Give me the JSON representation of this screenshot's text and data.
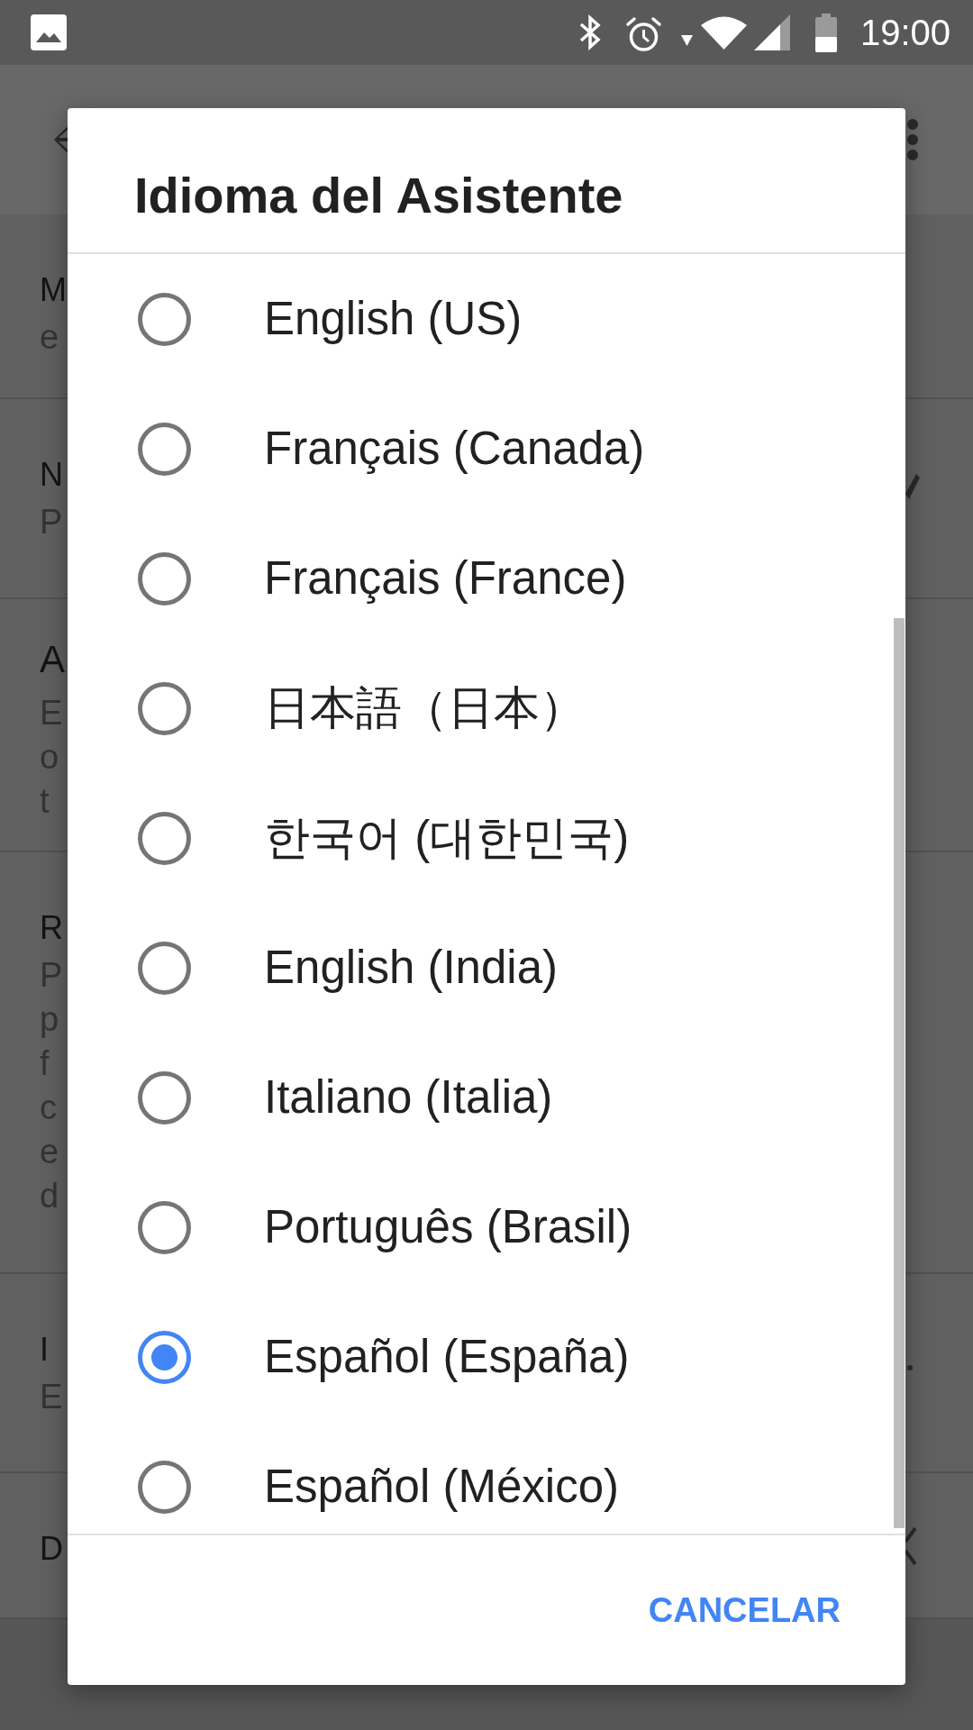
{
  "status_bar": {
    "time": "19:00"
  },
  "settings": {
    "rows": [
      {
        "kind": "item",
        "title": "M",
        "subtitle": [
          "e"
        ]
      },
      {
        "kind": "item",
        "title": "N",
        "subtitle": [
          "P"
        ]
      },
      {
        "kind": "header",
        "title": "A",
        "subtitle": [
          "E",
          "o",
          "t"
        ]
      },
      {
        "kind": "item",
        "title": "R",
        "subtitle": [
          "P",
          "p",
          "f",
          "c",
          "e",
          "d"
        ]
      },
      {
        "kind": "item",
        "title": "I",
        "subtitle": [
          "E"
        ]
      },
      {
        "kind": "item",
        "title": "D"
      }
    ]
  },
  "dialog": {
    "title": "Idioma del Asistente",
    "options": [
      {
        "label": "English (US)",
        "selected": false
      },
      {
        "label": "Français (Canada)",
        "selected": false
      },
      {
        "label": "Français (France)",
        "selected": false
      },
      {
        "label": "日本語（日本）",
        "selected": false
      },
      {
        "label": "한국어 (대한민국)",
        "selected": false
      },
      {
        "label": "English (India)",
        "selected": false
      },
      {
        "label": "Italiano (Italia)",
        "selected": false
      },
      {
        "label": "Português (Brasil)",
        "selected": false
      },
      {
        "label": "Español (España)",
        "selected": true
      },
      {
        "label": "Español (México)",
        "selected": false
      }
    ],
    "buttons": [
      "CANCELAR"
    ]
  }
}
